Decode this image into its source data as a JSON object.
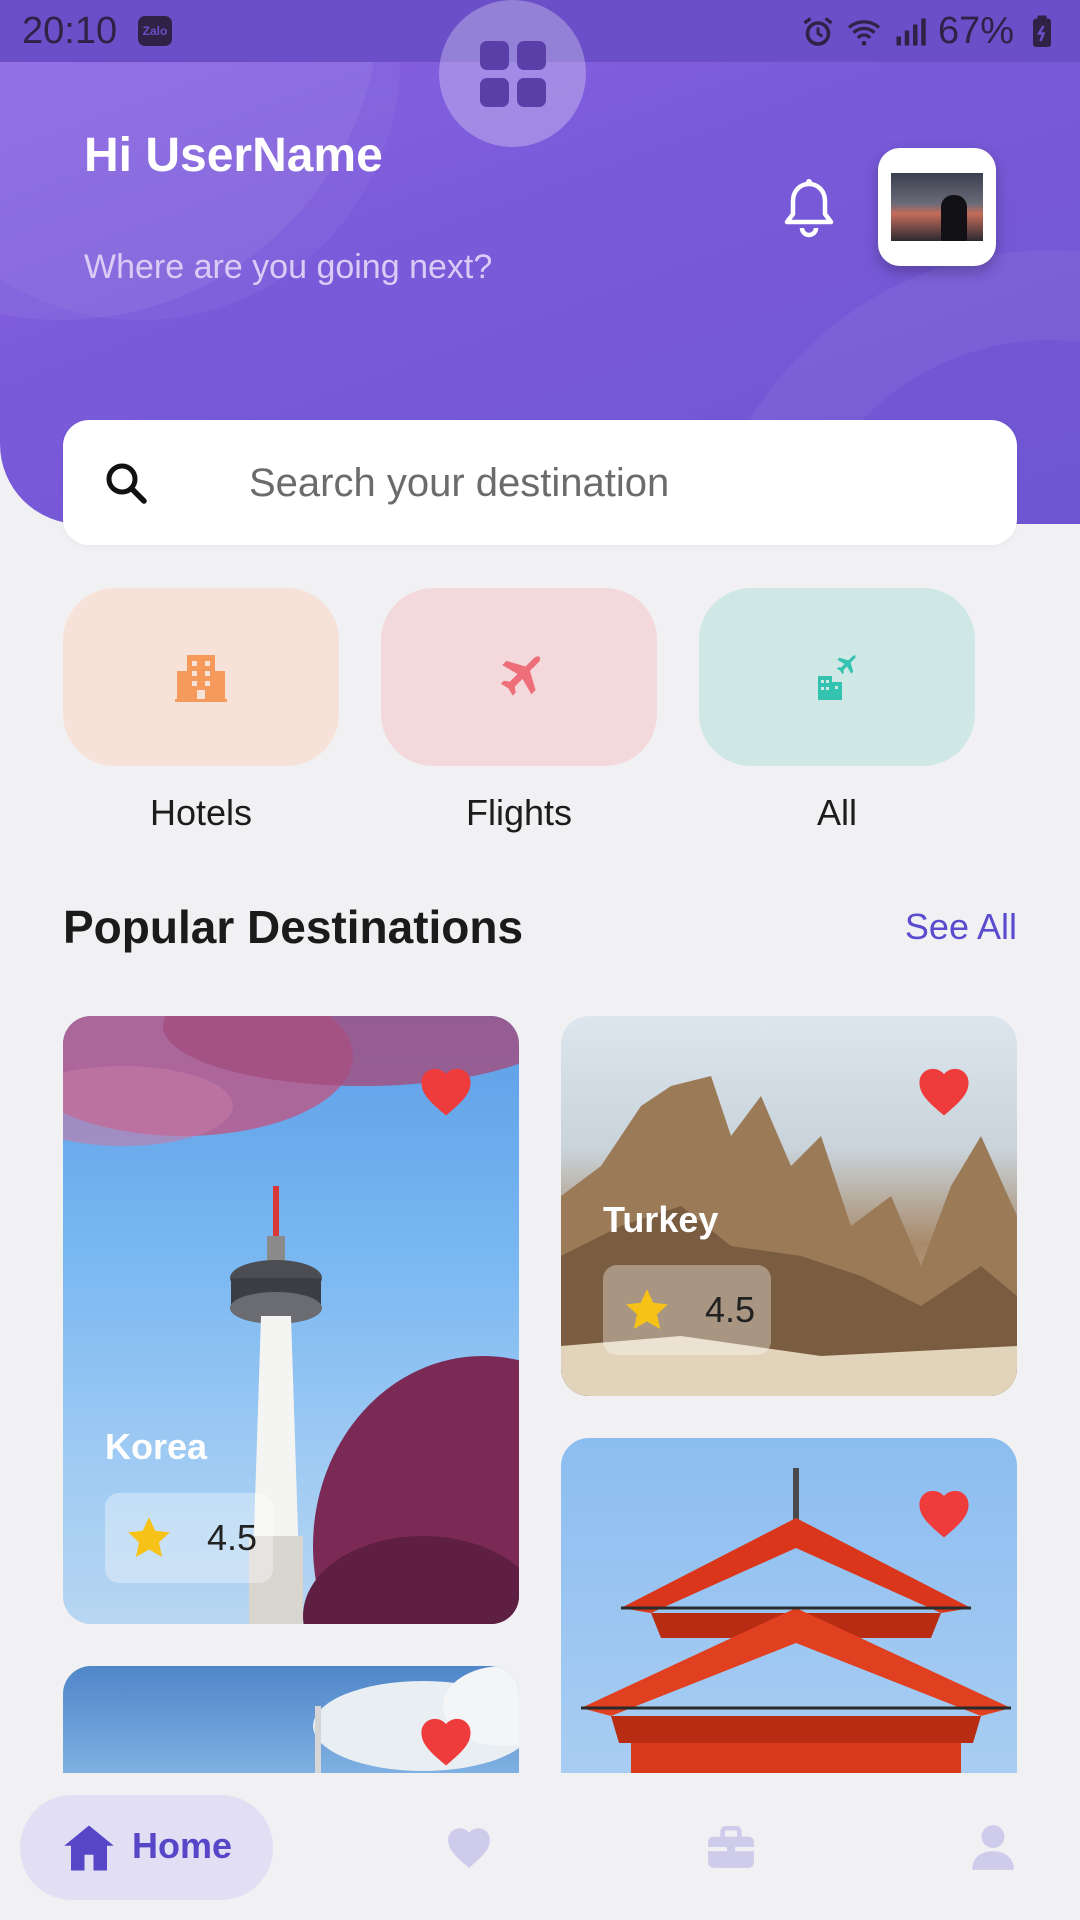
{
  "status_bar": {
    "time": "20:10",
    "app_badge": "Zalo",
    "battery": "67%",
    "icons": [
      "alarm-icon",
      "wifi-icon",
      "signal-icon",
      "battery-icon"
    ]
  },
  "header": {
    "greeting": "Hi UserName",
    "subtitle": "Where are you going next?",
    "accent_color": "#7a5ad9"
  },
  "search": {
    "placeholder": "Search your destination"
  },
  "categories": [
    {
      "label": "Hotels",
      "icon": "hotel-icon",
      "bg": "#f7e2d9",
      "color": "#f59a5b"
    },
    {
      "label": "Flights",
      "icon": "airplane-icon",
      "bg": "#f3d9dc",
      "color": "#ee6f79"
    },
    {
      "label": "All",
      "icon": "city-flight-icon",
      "bg": "#cfe8e6",
      "color": "#34c2b1"
    }
  ],
  "popular": {
    "title": "Popular Destinations",
    "see_all": "See All"
  },
  "destinations": [
    {
      "name": "Korea",
      "rating": "4.5"
    },
    {
      "name": "Turkey",
      "rating": "4.5"
    },
    {
      "name": "",
      "rating": ""
    },
    {
      "name": "",
      "rating": ""
    }
  ],
  "bottom_nav": {
    "home": "Home",
    "items": [
      "home-icon",
      "heart-icon",
      "briefcase-icon",
      "profile-icon"
    ]
  }
}
